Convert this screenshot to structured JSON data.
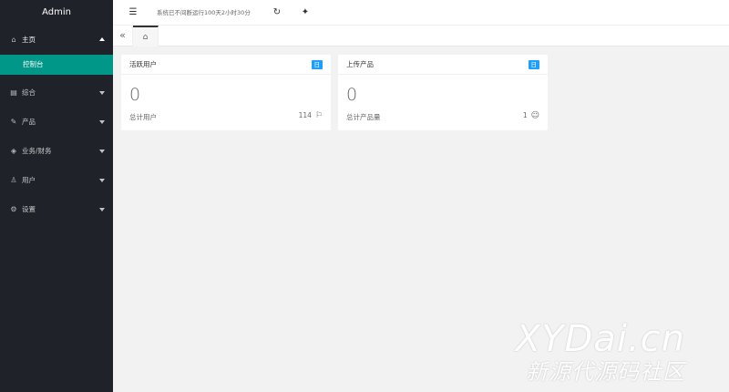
{
  "app": {
    "title": "Admin"
  },
  "sidebar": {
    "items": [
      {
        "label": "主页",
        "icon": "home-icon",
        "glyph": "⌂",
        "open": true
      },
      {
        "label": "综合",
        "icon": "book-icon",
        "glyph": "▤"
      },
      {
        "label": "产品",
        "icon": "edit-icon",
        "glyph": "✎"
      },
      {
        "label": "业务/财务",
        "icon": "box-icon",
        "glyph": "◈"
      },
      {
        "label": "用户",
        "icon": "user-icon",
        "glyph": "♙"
      },
      {
        "label": "设置",
        "icon": "gear-icon",
        "glyph": "⚙"
      }
    ],
    "sub_active": "控制台"
  },
  "topbar": {
    "status_text": "系统已不间断运行100天2小时30分",
    "menu_glyph": "☰",
    "refresh_glyph": "↻",
    "clean_glyph": "✦"
  },
  "tabs": {
    "prev_glyph": "«",
    "home_glyph": "⌂"
  },
  "cards": [
    {
      "title": "活跃用户",
      "badge": "日",
      "value": "0",
      "footer_label": "总计用户",
      "footer_value": "114",
      "footer_icon": "flag-icon",
      "footer_glyph": "⚐"
    },
    {
      "title": "上传产品",
      "badge": "日",
      "value": "0",
      "footer_label": "总计产品量",
      "footer_value": "1",
      "footer_icon": "smile-icon",
      "footer_glyph": "☺"
    }
  ],
  "watermark": {
    "line1": "XYDai.cn",
    "line2": "新源代源码社区"
  },
  "colors": {
    "sidebar_bg": "#20222a",
    "accent": "#009688",
    "badge": "#1e9fff"
  }
}
